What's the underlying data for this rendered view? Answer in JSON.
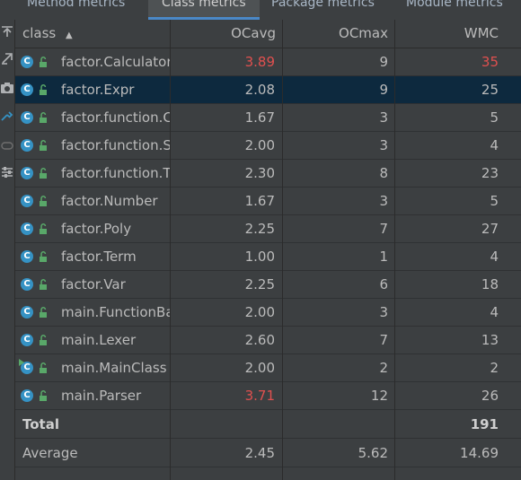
{
  "tabs": [
    {
      "label": "Method metrics",
      "active": false
    },
    {
      "label": "Class metrics",
      "active": true
    },
    {
      "label": "Package metrics",
      "active": false
    },
    {
      "label": "Module metrics",
      "active": false
    }
  ],
  "sidebar_icons": [
    "export-icon",
    "expand-icon",
    "camera-icon",
    "diff-icon",
    "toggle-icon",
    "settings-icon"
  ],
  "table": {
    "headers": {
      "class": "class",
      "sort_indicator": "▲",
      "ocavg": "OCavg",
      "ocmax": "OCmax",
      "wmc": "WMC"
    },
    "rows": [
      {
        "name": "factor.Calculator",
        "ocavg": "3.89",
        "ocmax": "9",
        "wmc": "35",
        "ocavg_alert": true,
        "wmc_alert": true
      },
      {
        "name": "factor.Expr",
        "ocavg": "2.08",
        "ocmax": "9",
        "wmc": "25",
        "selected": true
      },
      {
        "name": "factor.function.C",
        "ocavg": "1.67",
        "ocmax": "3",
        "wmc": "5"
      },
      {
        "name": "factor.function.S",
        "ocavg": "2.00",
        "ocmax": "3",
        "wmc": "4"
      },
      {
        "name": "factor.function.T",
        "ocavg": "2.30",
        "ocmax": "8",
        "wmc": "23"
      },
      {
        "name": "factor.Number",
        "ocavg": "1.67",
        "ocmax": "3",
        "wmc": "5"
      },
      {
        "name": "factor.Poly",
        "ocavg": "2.25",
        "ocmax": "7",
        "wmc": "27"
      },
      {
        "name": "factor.Term",
        "ocavg": "1.00",
        "ocmax": "1",
        "wmc": "4"
      },
      {
        "name": "factor.Var",
        "ocavg": "2.25",
        "ocmax": "6",
        "wmc": "18"
      },
      {
        "name": "main.FunctionBa:",
        "ocavg": "2.00",
        "ocmax": "3",
        "wmc": "4"
      },
      {
        "name": "main.Lexer",
        "ocavg": "2.60",
        "ocmax": "7",
        "wmc": "13"
      },
      {
        "name": "main.MainClass",
        "ocavg": "2.00",
        "ocmax": "2",
        "wmc": "2",
        "runnable": true
      },
      {
        "name": "main.Parser",
        "ocavg": "3.71",
        "ocmax": "12",
        "wmc": "26",
        "ocavg_alert": true
      }
    ],
    "total": {
      "label": "Total",
      "wmc": "191"
    },
    "average": {
      "label": "Average",
      "ocavg": "2.45",
      "ocmax": "5.62",
      "wmc": "14.69"
    },
    "class_icon_letter": "C"
  },
  "colors": {
    "accent": "#4a88c7",
    "alert": "#e0504f",
    "selection": "#0d293e",
    "class_icon": "#3592c4",
    "lock": "#59a869"
  }
}
